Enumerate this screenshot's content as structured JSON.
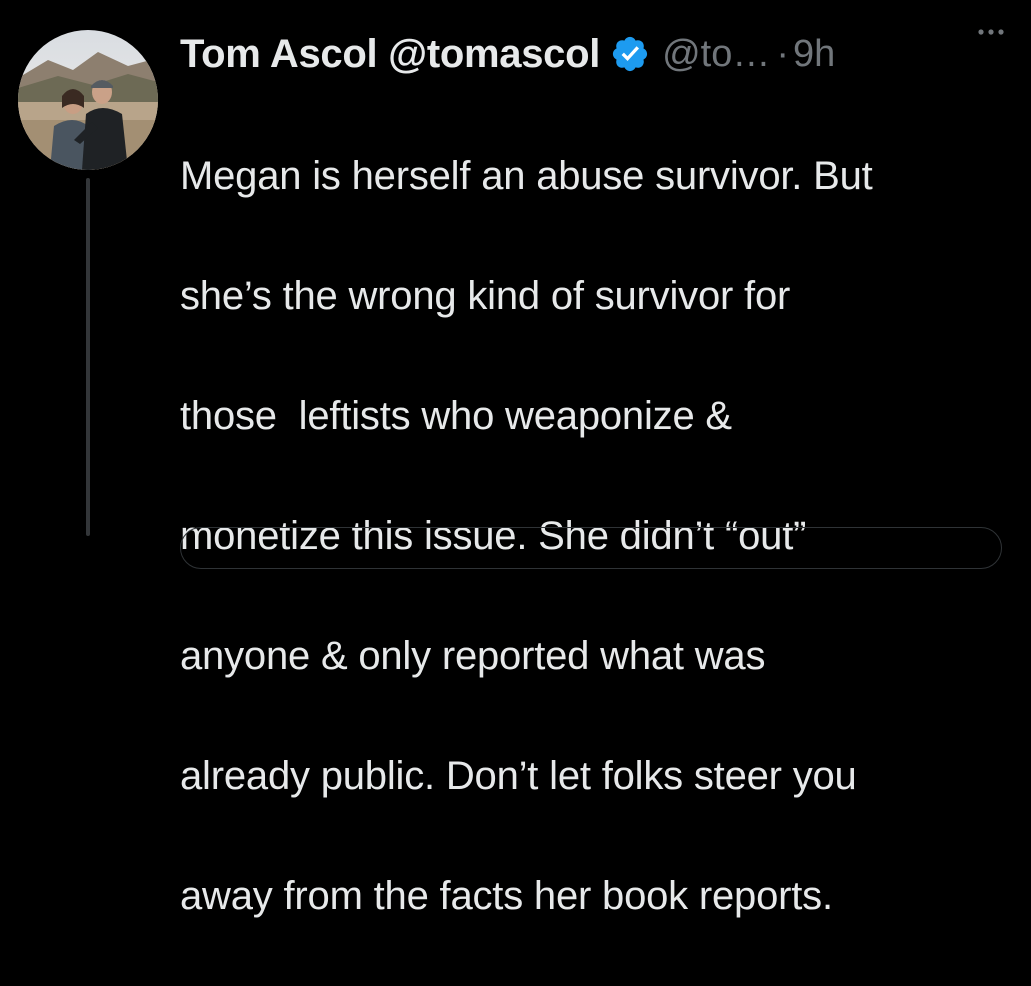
{
  "tweet": {
    "author": {
      "display_name": "Tom Ascol",
      "handle_full": "@tomascol",
      "handle_truncated": "@to…",
      "verified": true,
      "avatar_icon": "profile-photo-couple"
    },
    "separator": "·",
    "timestamp": "9h",
    "more_icon": "ellipsis-icon",
    "text_lines": [
      "Megan is herself an abuse survivor. But",
      "she’s the wrong kind of survivor for",
      "those  leftists who weaponize &",
      "monetize this issue. She didn’t “out”",
      "anyone & only reported what was",
      "already public. Don’t let folks steer you",
      "away from the facts her book reports."
    ]
  },
  "colors": {
    "background": "#000000",
    "primary_text": "#e7e9ea",
    "secondary_text": "#71767b",
    "verified_blue": "#1d9bf0",
    "thread_line": "#333639"
  }
}
